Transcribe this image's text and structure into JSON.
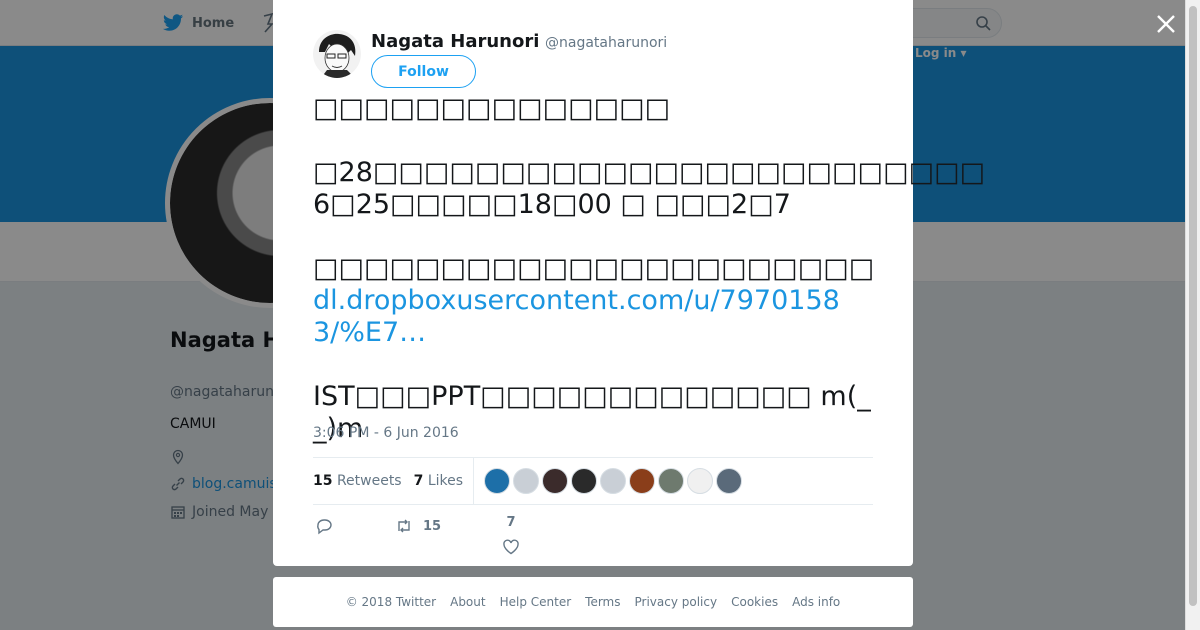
{
  "nav": {
    "home_label": "Home",
    "login_label": "Log in ▾"
  },
  "profile": {
    "name": "Nagata H",
    "handle": "@nagataharun",
    "bio": "CAMUI",
    "website": "blog.camuis",
    "joined": "Joined May"
  },
  "tweet": {
    "author_name": "Nagata Harunori",
    "author_handle": "@nagataharunori",
    "follow_label": "Follow",
    "text_lines": [
      "□□□□□□□□□□□□□□",
      "□28□□□□□□□□□□□□□□□□□□□□□□□□",
      "6□25□□□□□18□00 □ □□□2□7",
      "□□□□□□□□□□□□□□□□□□□□□□",
      "dl.dropboxusercontent.com/u/79701583/%E7…",
      "IST□□□PPT□□□□□□□□□□□□□ m(_ _)m"
    ],
    "timestamp": "3:06 PM - 6 Jun 2016",
    "retweets_count": "15",
    "retweets_label": "Retweets",
    "likes_count": "7",
    "likes_label": "Likes",
    "retweet_action_count": "15",
    "like_action_count": "7"
  },
  "likers": [
    "#1d6fa8",
    "#c9cfd6",
    "#3b2b2b",
    "#2a2a2a",
    "#c9cfd6",
    "#8a3e1a",
    "#6e7a6e",
    "#f0f0f0",
    "#5a6a7a"
  ],
  "footer": {
    "links": [
      "© 2018 Twitter",
      "About",
      "Help Center",
      "Terms",
      "Privacy policy",
      "Cookies",
      "Ads info"
    ]
  },
  "colors": {
    "accent": "#1da1f2",
    "link": "#1b95e0",
    "banner": "#1b95e0",
    "muted": "#657786"
  }
}
